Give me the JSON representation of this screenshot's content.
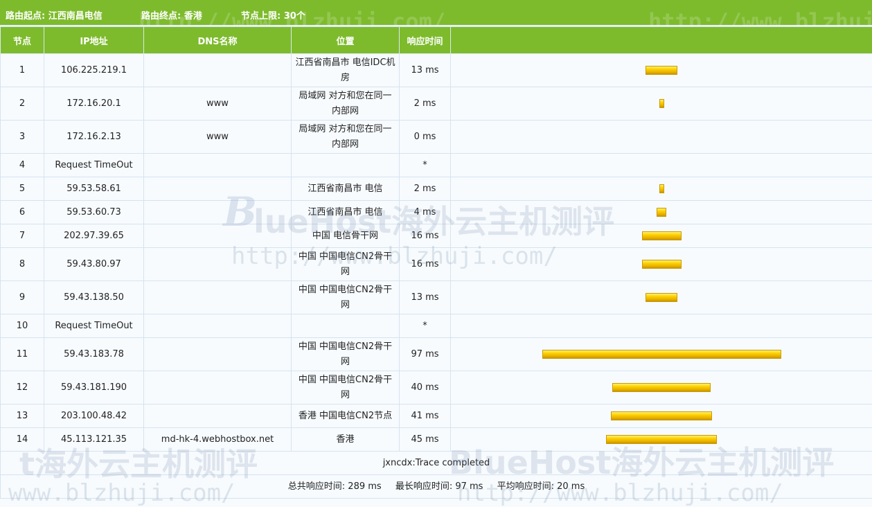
{
  "header": {
    "route_start": "路由起点: 江西南昌电信",
    "route_end": "路由终点: 香港",
    "hop_limit": "节点上限: 30个"
  },
  "columns": {
    "hop": "节点",
    "ip": "IP地址",
    "dns": "DNS名称",
    "location": "位置",
    "time": "响应时间"
  },
  "rows": [
    {
      "hop": "1",
      "ip": "106.225.219.1",
      "dns": "",
      "location": "江西省南昌市 电信IDC机房",
      "time": "13 ms",
      "ms": 13
    },
    {
      "hop": "2",
      "ip": "172.16.20.1",
      "dns": "www",
      "location": "局域网 对方和您在同一内部网",
      "time": "2 ms",
      "ms": 2
    },
    {
      "hop": "3",
      "ip": "172.16.2.13",
      "dns": "www",
      "location": "局域网 对方和您在同一内部网",
      "time": "0 ms",
      "ms": 0
    },
    {
      "hop": "4",
      "ip": "Request TimeOut",
      "dns": "",
      "location": "",
      "time": "*",
      "ms": null
    },
    {
      "hop": "5",
      "ip": "59.53.58.61",
      "dns": "",
      "location": "江西省南昌市 电信",
      "time": "2 ms",
      "ms": 2
    },
    {
      "hop": "6",
      "ip": "59.53.60.73",
      "dns": "",
      "location": "江西省南昌市 电信",
      "time": "4 ms",
      "ms": 4
    },
    {
      "hop": "7",
      "ip": "202.97.39.65",
      "dns": "",
      "location": "中国 电信骨干网",
      "time": "16 ms",
      "ms": 16
    },
    {
      "hop": "8",
      "ip": "59.43.80.97",
      "dns": "",
      "location": "中国 中国电信CN2骨干网",
      "time": "16 ms",
      "ms": 16
    },
    {
      "hop": "9",
      "ip": "59.43.138.50",
      "dns": "",
      "location": "中国 中国电信CN2骨干网",
      "time": "13 ms",
      "ms": 13
    },
    {
      "hop": "10",
      "ip": "Request TimeOut",
      "dns": "",
      "location": "",
      "time": "*",
      "ms": null
    },
    {
      "hop": "11",
      "ip": "59.43.183.78",
      "dns": "",
      "location": "中国 中国电信CN2骨干网",
      "time": "97 ms",
      "ms": 97
    },
    {
      "hop": "12",
      "ip": "59.43.181.190",
      "dns": "",
      "location": "中国 中国电信CN2骨干网",
      "time": "40 ms",
      "ms": 40
    },
    {
      "hop": "13",
      "ip": "203.100.48.42",
      "dns": "",
      "location": "香港 中国电信CN2节点",
      "time": "41 ms",
      "ms": 41
    },
    {
      "hop": "14",
      "ip": "45.113.121.35",
      "dns": "md-hk-4.webhostbox.net",
      "location": "香港",
      "time": "45 ms",
      "ms": 45
    }
  ],
  "footer": {
    "completed": "jxncdx:Trace completed",
    "total": "总共响应时间: 289 ms",
    "max": "最长响应时间: 97 ms",
    "avg": "平均响应时间: 20 ms"
  },
  "watermark": {
    "url": "http://www.blzhuji.com/",
    "logo_b": "B",
    "brand": "lueHost海外云主机测评",
    "brand_full": "BlueHost海外云主机测评",
    "cut_brand": "t海外云主机测评",
    "cut_url": "www.blzhuji.com/"
  },
  "colors": {
    "header_green": "#7dbb2c",
    "bar_yellow": "#ffd200",
    "page_bg": "#f7fbfe"
  }
}
